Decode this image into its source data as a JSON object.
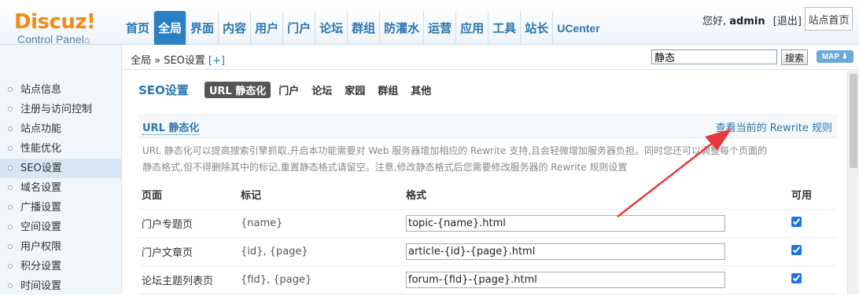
{
  "brand": {
    "logo": "Discuz!",
    "subtitle": "Control Panel",
    "home_icon": "house-icon"
  },
  "nav": [
    {
      "label": "首页",
      "active": false
    },
    {
      "label": "全局",
      "active": true
    },
    {
      "label": "界面",
      "active": false
    },
    {
      "label": "内容",
      "active": false
    },
    {
      "label": "用户",
      "active": false
    },
    {
      "label": "门户",
      "active": false
    },
    {
      "label": "论坛",
      "active": false
    },
    {
      "label": "群组",
      "active": false
    },
    {
      "label": "防灌水",
      "active": false
    },
    {
      "label": "运营",
      "active": false
    },
    {
      "label": "应用",
      "active": false
    },
    {
      "label": "工具",
      "active": false
    },
    {
      "label": "站长",
      "active": false
    },
    {
      "label": "UCenter",
      "active": false
    }
  ],
  "user": {
    "greeting": "您好,",
    "name": "admin",
    "logout": "[退出]",
    "site_home": "站点首页"
  },
  "subbar": {
    "breadcrumb": "全局 » SEO设置",
    "add": "[+]",
    "search_value": "静态",
    "search_button": "搜索",
    "map_button": "MAP ⬇"
  },
  "sidebar": {
    "items": [
      {
        "label": "站点信息",
        "active": false
      },
      {
        "label": "注册与访问控制",
        "active": false
      },
      {
        "label": "站点功能",
        "active": false
      },
      {
        "label": "性能优化",
        "active": false
      },
      {
        "label": "SEO设置",
        "active": true
      },
      {
        "label": "域名设置",
        "active": false
      },
      {
        "label": "广播设置",
        "active": false
      },
      {
        "label": "空间设置",
        "active": false
      },
      {
        "label": "用户权限",
        "active": false
      },
      {
        "label": "积分设置",
        "active": false
      },
      {
        "label": "时间设置",
        "active": false
      }
    ]
  },
  "main": {
    "title": "SEO设置",
    "tabs": [
      {
        "label": "URL 静态化",
        "active": true
      },
      {
        "label": "门户",
        "active": false
      },
      {
        "label": "论坛",
        "active": false
      },
      {
        "label": "家园",
        "active": false
      },
      {
        "label": "群组",
        "active": false
      },
      {
        "label": "其他",
        "active": false
      }
    ],
    "section_title": "URL 静态化",
    "rewrite_link": "查看当前的 Rewrite 规则",
    "description_line1": "URL 静态化可以提高搜索引擎抓取,开启本功能需要对 Web 服务器增加相应的 Rewrite 支持,且会轻微增加服务器负担。同时您还可以调整每个页面的",
    "description_line2": "静态格式,但不得删除其中的标记,重置静态格式请留空。注意,修改静态格式后您需要修改服务器的 Rewrite 规则设置",
    "table": {
      "headers": {
        "page": "页面",
        "tag": "标记",
        "format": "格式",
        "enabled": "可用"
      },
      "rows": [
        {
          "page": "门户专题页",
          "tag": "{name}",
          "format": "topic-{name}.html",
          "enabled": true
        },
        {
          "page": "门户文章页",
          "tag": "{id}, {page}",
          "format": "article-{id}-{page}.html",
          "enabled": true
        },
        {
          "page": "论坛主题列表页",
          "tag": "{fid}, {page}",
          "format": "forum-{fid}-{page}.html",
          "enabled": true
        }
      ]
    }
  },
  "colors": {
    "accent": "#2b76b0",
    "logo": "#f38b18",
    "nav_active_bg": "#2980c4",
    "annotation_arrow": "#e8383d"
  }
}
